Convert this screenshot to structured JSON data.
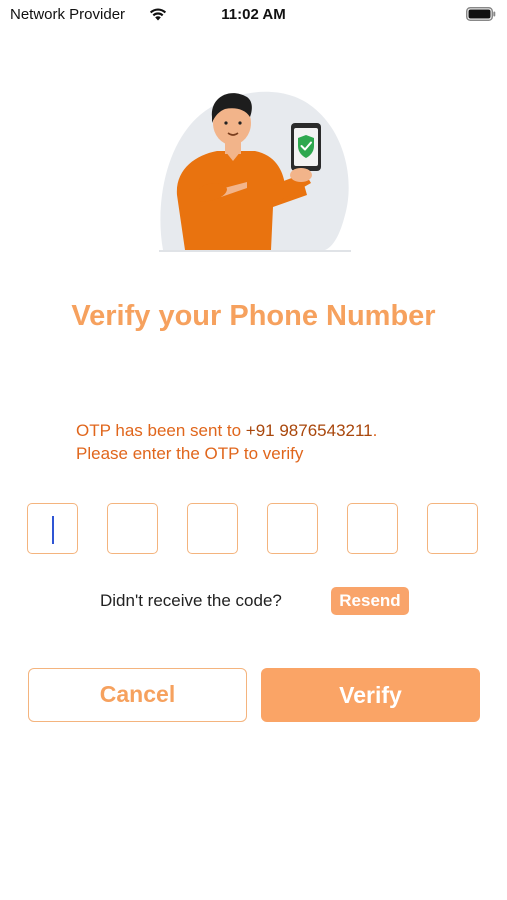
{
  "status_bar": {
    "carrier": "Network Provider",
    "time": "11:02 AM",
    "icons": [
      "wifi-icon",
      "battery-icon"
    ]
  },
  "illustration": {
    "name": "person-holding-phone-with-shield-check"
  },
  "title": "Verify your Phone Number",
  "otp_message": {
    "prefix": "OTP has been sent to ",
    "phone": "+91 9876543211",
    "suffix": ".",
    "line2": "Please enter the OTP to verify"
  },
  "otp": {
    "digits": [
      "",
      "",
      "",
      "",
      "",
      ""
    ],
    "active_index": 0
  },
  "resend": {
    "question": "Didn't receive the code?",
    "button_label": "Resend"
  },
  "actions": {
    "cancel_label": "Cancel",
    "verify_label": "Verify"
  },
  "colors": {
    "accent": "#F6A15E",
    "accent_dark": "#E0661C",
    "button_fill": "#FAA466",
    "border": "#F4B47E",
    "cursor": "#2F55D4"
  }
}
